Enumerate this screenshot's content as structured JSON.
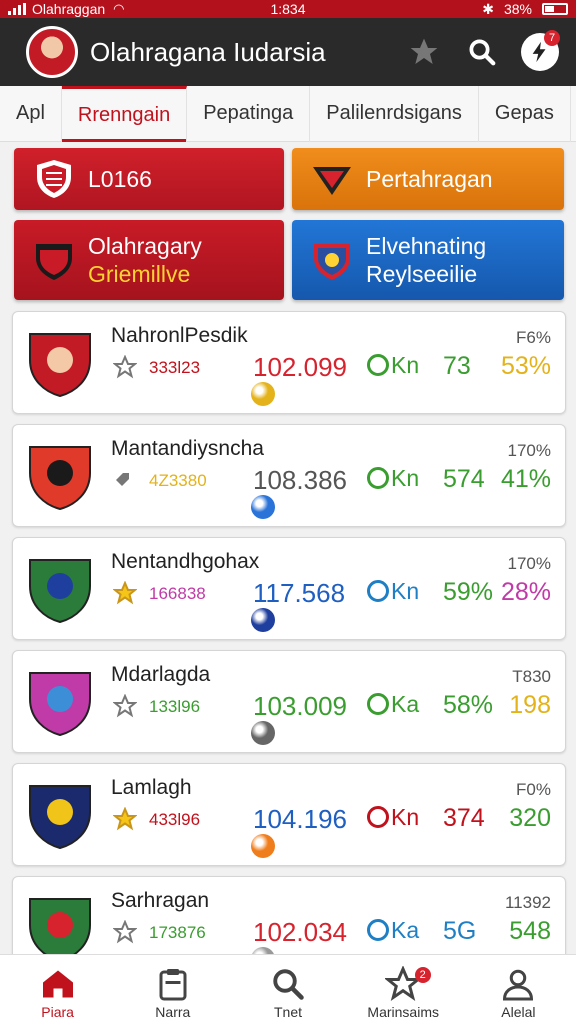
{
  "status": {
    "carrier": "Olahraggan",
    "time": "1:834",
    "battery": "38%"
  },
  "header": {
    "title": "Olahragana Iudarsia",
    "notification_count": "7"
  },
  "tabs": [
    {
      "label": "Apl"
    },
    {
      "label": "Rrenngain"
    },
    {
      "label": "Pepatinga"
    },
    {
      "label": "Palilenrdsigans"
    },
    {
      "label": "Gepas"
    }
  ],
  "categories": [
    {
      "label": "L0166",
      "sub": ""
    },
    {
      "label": "Pertahragan",
      "sub": ""
    },
    {
      "label": "Olahragary",
      "sub": "Griemillve"
    },
    {
      "label": "Elvehnating",
      "sub": "Reylseeilie"
    }
  ],
  "items": [
    {
      "name": "NahronlPesdik",
      "top_right": "F6%",
      "code": "333l23",
      "score": "102.099",
      "ok": "Kn",
      "val1": "73",
      "val2": "53%",
      "star": "outline",
      "colors": {
        "code": "#c0121d",
        "score": "#d6232e",
        "ok": "#3a9d2f",
        "val1": "#3a9d2f",
        "val2": "#e4b21a"
      }
    },
    {
      "name": "Mantandiysncha",
      "top_right": "170%",
      "code": "4Z3380",
      "score": "108.386",
      "ok": "Kn",
      "val1": "574",
      "val2": "41%",
      "star": "tag",
      "colors": {
        "code": "#e4b21a",
        "score": "#555555",
        "ok": "#3a9d2f",
        "val1": "#3a9d2f",
        "val2": "#3a9d2f"
      }
    },
    {
      "name": "Nentandhgohax",
      "top_right": "170%",
      "code": "166838",
      "score": "117.568",
      "ok": "Kn",
      "val1": "59%",
      "val2": "28%",
      "star": "gold",
      "colors": {
        "code": "#c03aa8",
        "score": "#1f5fc2",
        "ok": "#1f7fc4",
        "val1": "#3a9d2f",
        "val2": "#c03aa8"
      }
    },
    {
      "name": "Mdarlagda",
      "top_right": "T830",
      "code": "133l96",
      "score": "103.009",
      "ok": "Ka",
      "val1": "58%",
      "val2": "198",
      "star": "outline",
      "colors": {
        "code": "#3a9d2f",
        "score": "#3a9d2f",
        "ok": "#3a9d2f",
        "val1": "#3a9d2f",
        "val2": "#e4b21a"
      }
    },
    {
      "name": "Lamlagh",
      "top_right": "F0%",
      "code": "433l96",
      "score": "104.196",
      "ok": "Kn",
      "val1": "374",
      "val2": "320",
      "star": "gold",
      "colors": {
        "code": "#c0121d",
        "score": "#1f5fc2",
        "ok": "#c0121d",
        "val1": "#c0121d",
        "val2": "#3a9d2f"
      }
    },
    {
      "name": "Sarhragan",
      "top_right": "11392",
      "code": "173876",
      "score": "102.034",
      "ok": "Ka",
      "val1": "5G",
      "val2": "548",
      "star": "outline",
      "colors": {
        "code": "#3a9d2f",
        "score": "#d6232e",
        "ok": "#1f7fc4",
        "val1": "#1f7fc4",
        "val2": "#3a9d2f"
      }
    }
  ],
  "bottom_nav": [
    {
      "label": "Piara",
      "icon": "home-icon",
      "active": true
    },
    {
      "label": "Narra",
      "icon": "clipboard-icon"
    },
    {
      "label": "Tnet",
      "icon": "search-icon"
    },
    {
      "label": "Marinsaims",
      "icon": "star-icon",
      "badge": "2"
    },
    {
      "label": "Alelal",
      "icon": "profile-icon"
    }
  ]
}
